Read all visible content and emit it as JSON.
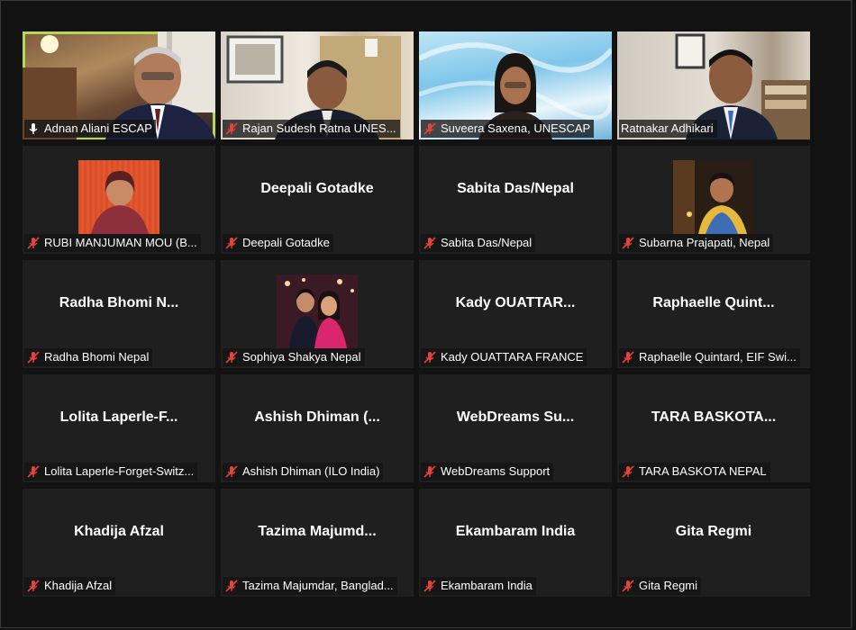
{
  "colors": {
    "active_border": "#b9d74a",
    "mic_muted": "#e8413b",
    "tile_bg": "#1f1f1f"
  },
  "participants": [
    {
      "label": "Adnan Aliani ESCAP",
      "mic": "unmuted"
    },
    {
      "label": "Rajan Sudesh Ratna UNES...",
      "mic": "muted"
    },
    {
      "label": "Suveera Saxena, UNESCAP",
      "mic": "muted"
    },
    {
      "label": "Ratnakar Adhikari",
      "mic": "none"
    },
    {
      "label": "RUBI MANJUMAN MOU (B...",
      "mic": "muted"
    },
    {
      "display": "Deepali Gotadke",
      "label": "Deepali Gotadke",
      "mic": "muted"
    },
    {
      "display": "Sabita Das/Nepal",
      "label": "Sabita Das/Nepal",
      "mic": "muted"
    },
    {
      "label": "Subarna Prajapati, Nepal",
      "mic": "muted"
    },
    {
      "display": "Radha Bhomi N...",
      "label": "Radha Bhomi Nepal",
      "mic": "muted"
    },
    {
      "label": "Sophiya Shakya Nepal",
      "mic": "muted"
    },
    {
      "display": "Kady OUATTAR...",
      "label": "Kady OUATTARA FRANCE",
      "mic": "muted"
    },
    {
      "display": "Raphaelle Quint...",
      "label": "Raphaelle Quintard, EIF Swi...",
      "mic": "muted"
    },
    {
      "display": "Lolita Laperle-F...",
      "label": "Lolita Laperle-Forget-Switz...",
      "mic": "muted"
    },
    {
      "display": "Ashish Dhiman (...",
      "label": "Ashish Dhiman (ILO India)",
      "mic": "muted"
    },
    {
      "display": "WebDreams Su...",
      "label": "WebDreams Support",
      "mic": "muted"
    },
    {
      "display": "TARA BASKOTA...",
      "label": "TARA BASKOTA NEPAL",
      "mic": "muted"
    },
    {
      "display": "Khadija Afzal",
      "label": "Khadija Afzal",
      "mic": "muted"
    },
    {
      "display": "Tazima Majumd...",
      "label": "Tazima Majumdar, Banglad...",
      "mic": "muted"
    },
    {
      "display": "Ekambaram India",
      "label": "Ekambaram India",
      "mic": "muted"
    },
    {
      "display": "Gita Regmi",
      "label": "Gita Regmi",
      "mic": "muted"
    }
  ]
}
